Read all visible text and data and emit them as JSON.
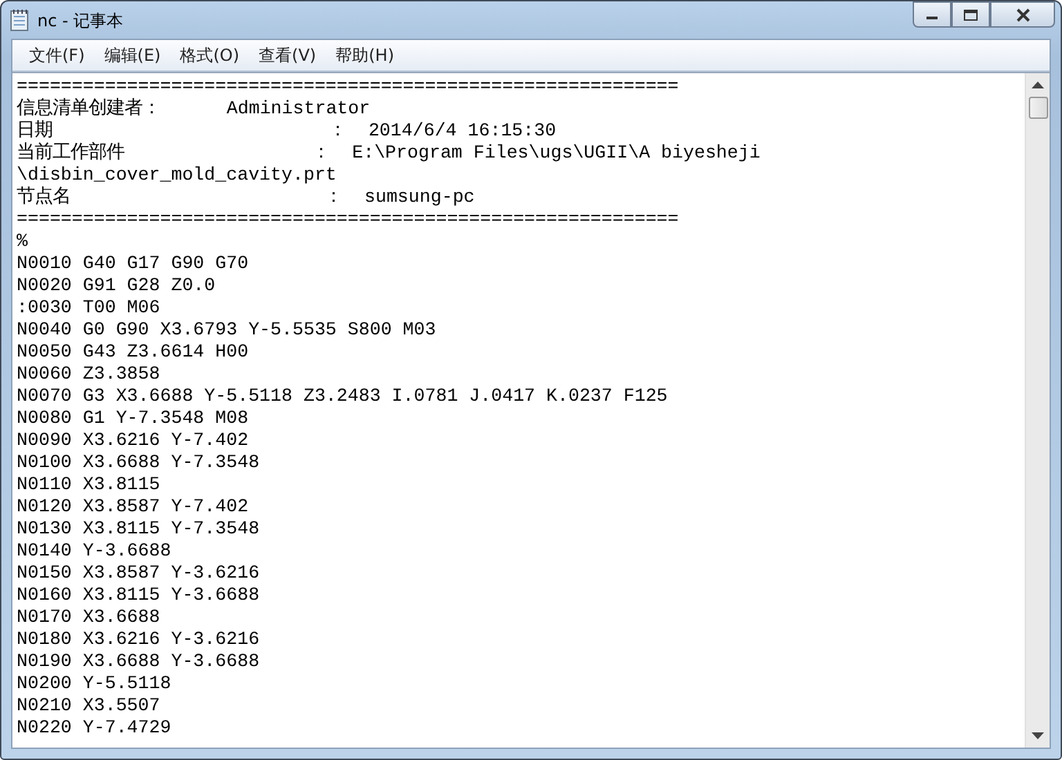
{
  "window": {
    "title": "nc - 记事本"
  },
  "menu": [
    "文件(F)",
    "编辑(E)",
    "格式(O)",
    "查看(V)",
    "帮助(H)"
  ],
  "lines": [
    "============================================================",
    "信息清单创建者：      Administrator",
    "日期                         ：  2014/6/4 16:15:30",
    "当前工作部件                 ：  E:\\Program Files\\ugs\\UGII\\A biyesheji",
    "\\disbin_cover_mold_cavity.prt",
    "节点名                       ：  sumsung-pc",
    "============================================================",
    "%",
    "N0010 G40 G17 G90 G70",
    "N0020 G91 G28 Z0.0",
    ":0030 T00 M06",
    "N0040 G0 G90 X3.6793 Y-5.5535 S800 M03",
    "N0050 G43 Z3.6614 H00",
    "N0060 Z3.3858",
    "N0070 G3 X3.6688 Y-5.5118 Z3.2483 I.0781 J.0417 K.0237 F125",
    "N0080 G1 Y-7.3548 M08",
    "N0090 X3.6216 Y-7.402",
    "N0100 X3.6688 Y-7.3548",
    "N0110 X3.8115",
    "N0120 X3.8587 Y-7.402",
    "N0130 X3.8115 Y-7.3548",
    "N0140 Y-3.6688",
    "N0150 X3.8587 Y-3.6216",
    "N0160 X3.8115 Y-3.6688",
    "N0170 X3.6688",
    "N0180 X3.6216 Y-3.6216",
    "N0190 X3.6688 Y-3.6688",
    "N0200 Y-5.5118",
    "N0210 X3.5507",
    "N0220 Y-7.4729"
  ]
}
